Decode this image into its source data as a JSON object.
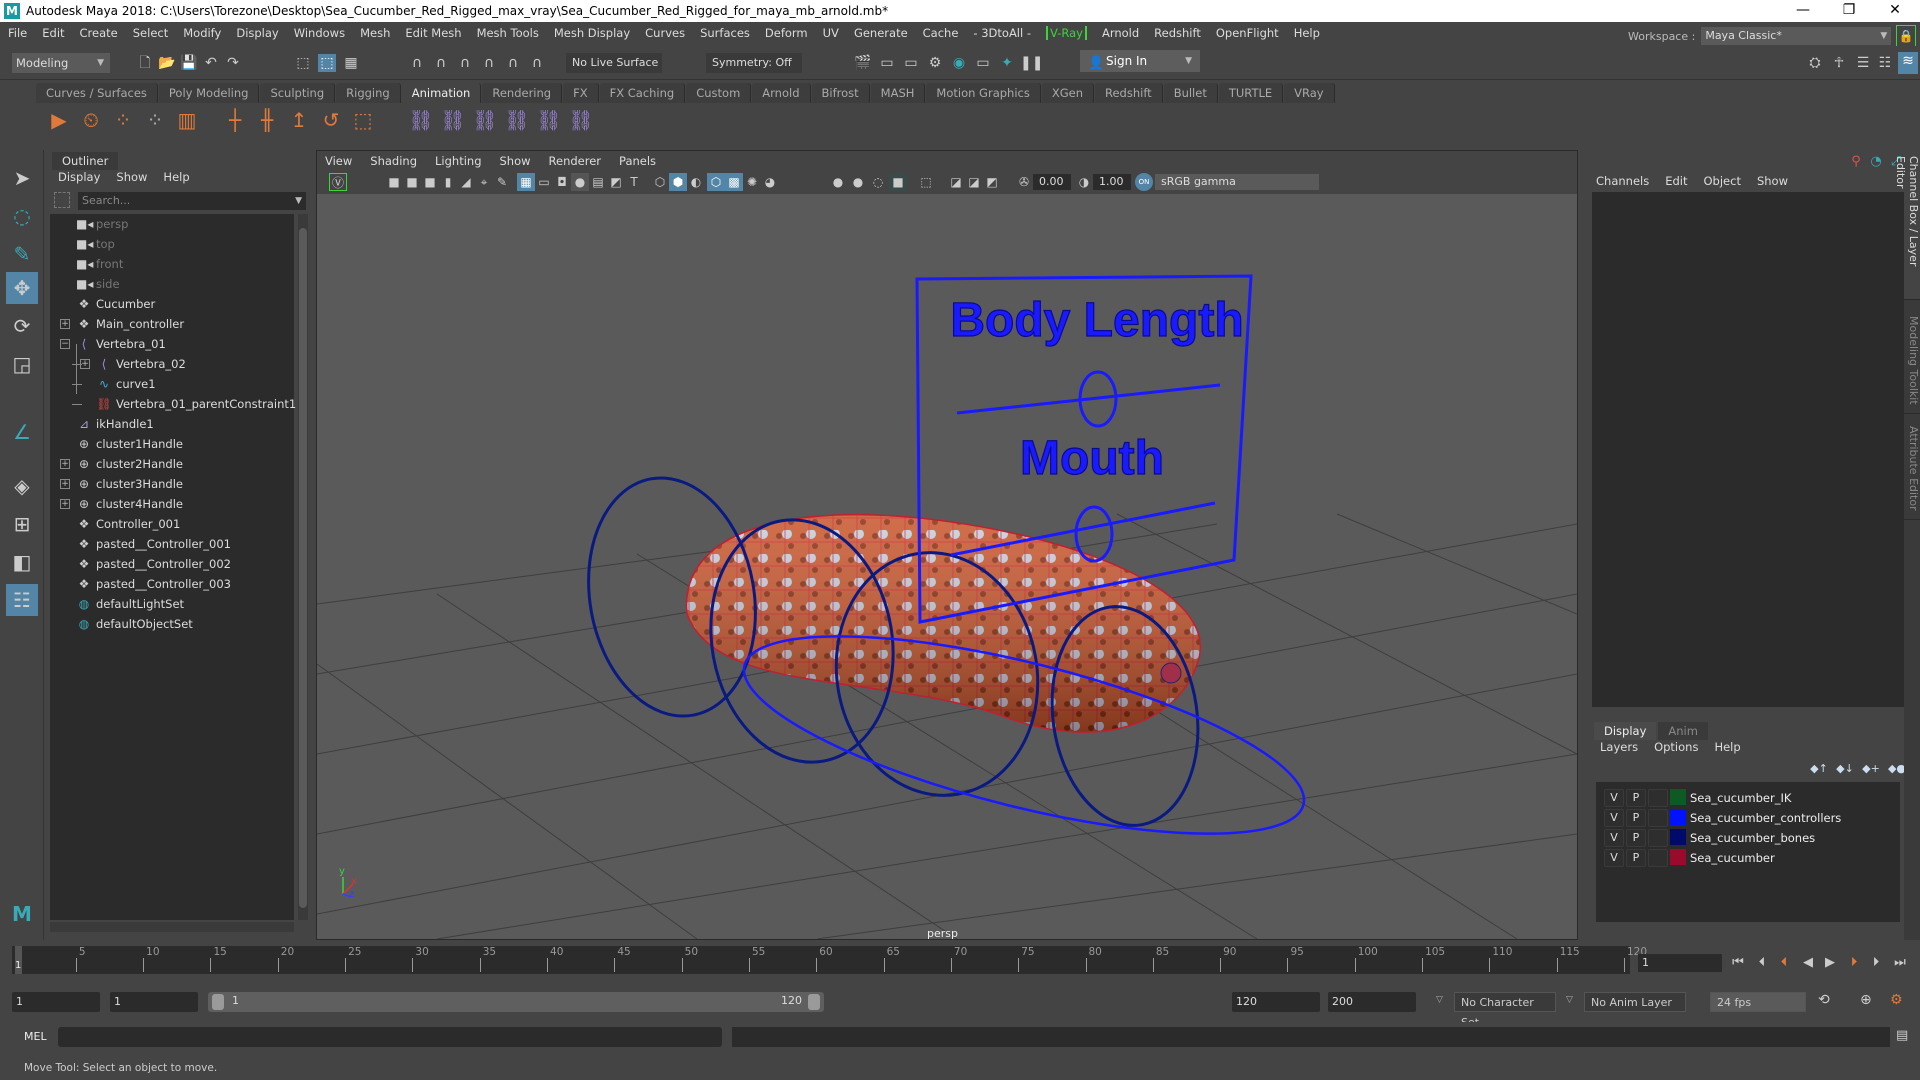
{
  "window": {
    "title": "Autodesk Maya 2018: C:\\Users\\Torezone\\Desktop\\Sea_Cucumber_Red_Rigged_max_vray\\Sea_Cucumber_Red_Rigged_for_maya_mb_arnold.mb*",
    "app_icon": "maya-logo-icon",
    "controls": {
      "minimize": "—",
      "maximize": "❐",
      "close": "✕"
    }
  },
  "menubar": {
    "items": [
      "File",
      "Edit",
      "Create",
      "Select",
      "Modify",
      "Display",
      "Windows",
      "Mesh",
      "Edit Mesh",
      "Mesh Tools",
      "Mesh Display",
      "Curves",
      "Surfaces",
      "Deform",
      "UV",
      "Generate",
      "Cache",
      "- 3DtoAll -",
      "V-Ray",
      "Arnold",
      "Redshift",
      "OpenFlight",
      "Help"
    ],
    "workspace_label": "Workspace :",
    "workspace_value": "Maya Classic*"
  },
  "statusline": {
    "mode": "Modeling",
    "live_surface": "No Live Surface",
    "symmetry": "Symmetry: Off",
    "sign_in": "Sign In"
  },
  "shelf": {
    "tabs": [
      "Curves / Surfaces",
      "Poly Modeling",
      "Sculpting",
      "Rigging",
      "Animation",
      "Rendering",
      "FX",
      "FX Caching",
      "Custom",
      "Arnold",
      "Bifrost",
      "MASH",
      "Motion Graphics",
      "XGen",
      "Redshift",
      "Bullet",
      "TURTLE",
      "VRay"
    ],
    "active_tab": "Animation"
  },
  "outliner": {
    "tab": "Outliner",
    "menu": [
      "Display",
      "Show",
      "Help"
    ],
    "search_placeholder": "Search...",
    "items": [
      {
        "label": "persp",
        "icon": "camera-icon",
        "dim": true,
        "indent": 0,
        "expand": ""
      },
      {
        "label": "top",
        "icon": "camera-icon",
        "dim": true,
        "indent": 0,
        "expand": ""
      },
      {
        "label": "front",
        "icon": "camera-icon",
        "dim": true,
        "indent": 0,
        "expand": ""
      },
      {
        "label": "side",
        "icon": "camera-icon",
        "dim": true,
        "indent": 0,
        "expand": ""
      },
      {
        "label": "Cucumber",
        "icon": "transform-icon",
        "dim": false,
        "indent": 0,
        "expand": ""
      },
      {
        "label": "Main_controller",
        "icon": "transform-icon",
        "dim": false,
        "indent": 0,
        "expand": "+"
      },
      {
        "label": "Vertebra_01",
        "icon": "joint-icon",
        "dim": false,
        "indent": 0,
        "expand": "−"
      },
      {
        "label": "Vertebra_02",
        "icon": "joint-icon",
        "dim": false,
        "indent": 1,
        "expand": "+"
      },
      {
        "label": "curve1",
        "icon": "curve-icon",
        "dim": false,
        "indent": 1,
        "expand": ""
      },
      {
        "label": "Vertebra_01_parentConstraint1",
        "icon": "constraint-icon",
        "dim": false,
        "indent": 1,
        "expand": ""
      },
      {
        "label": "ikHandle1",
        "icon": "ik-handle-icon",
        "dim": false,
        "indent": 0,
        "expand": ""
      },
      {
        "label": "cluster1Handle",
        "icon": "cluster-icon",
        "dim": false,
        "indent": 0,
        "expand": ""
      },
      {
        "label": "cluster2Handle",
        "icon": "cluster-icon",
        "dim": false,
        "indent": 0,
        "expand": "+"
      },
      {
        "label": "cluster3Handle",
        "icon": "cluster-icon",
        "dim": false,
        "indent": 0,
        "expand": "+"
      },
      {
        "label": "cluster4Handle",
        "icon": "cluster-icon",
        "dim": false,
        "indent": 0,
        "expand": "+"
      },
      {
        "label": "Controller_001",
        "icon": "transform-icon",
        "dim": false,
        "indent": 0,
        "expand": ""
      },
      {
        "label": "pasted__Controller_001",
        "icon": "transform-icon",
        "dim": false,
        "indent": 0,
        "expand": ""
      },
      {
        "label": "pasted__Controller_002",
        "icon": "transform-icon",
        "dim": false,
        "indent": 0,
        "expand": ""
      },
      {
        "label": "pasted__Controller_003",
        "icon": "transform-icon",
        "dim": false,
        "indent": 0,
        "expand": ""
      },
      {
        "label": "defaultLightSet",
        "icon": "set-icon",
        "dim": false,
        "indent": 0,
        "expand": ""
      },
      {
        "label": "defaultObjectSet",
        "icon": "set-icon",
        "dim": false,
        "indent": 0,
        "expand": ""
      }
    ]
  },
  "viewport": {
    "menu": [
      "View",
      "Shading",
      "Lighting",
      "Show",
      "Renderer",
      "Panels"
    ],
    "exposure": "0.00",
    "gamma": "1.00",
    "color_space": "sRGB gamma",
    "color_mgmt": "ON",
    "camera_label": "persp",
    "sign_text_1": "Body Length",
    "sign_text_2": "Mouth",
    "axis": {
      "y": "y",
      "x": "x",
      "z": "z"
    }
  },
  "channelbox": {
    "menu": [
      "Channels",
      "Edit",
      "Object",
      "Show"
    ],
    "side_tabs": [
      "Channel Box / Layer Editor",
      "Modeling Toolkit",
      "Attribute Editor"
    ]
  },
  "layers": {
    "tabs": [
      "Display",
      "Anim"
    ],
    "active_tab": "Display",
    "menu": [
      "Layers",
      "Options",
      "Help"
    ],
    "items": [
      {
        "v": "V",
        "p": "P",
        "name": "Sea_cucumber_IK",
        "color": "#0d5a24"
      },
      {
        "v": "V",
        "p": "P",
        "name": "Sea_cucumber_controllers",
        "color": "#0012ff"
      },
      {
        "v": "V",
        "p": "P",
        "name": "Sea_cucumber_bones",
        "color": "#000a6a"
      },
      {
        "v": "V",
        "p": "P",
        "name": "Sea_cucumber",
        "color": "#9a0a2a"
      }
    ]
  },
  "timeline": {
    "ticks": [
      5,
      10,
      15,
      20,
      25,
      30,
      35,
      40,
      45,
      50,
      55,
      60,
      65,
      70,
      75,
      80,
      85,
      90,
      95,
      100,
      105,
      110,
      115,
      120
    ],
    "min": 1,
    "max": 120,
    "current_frame": "1",
    "current_field": "1"
  },
  "range": {
    "start": "1",
    "playback_start": "1",
    "slider_start": "1",
    "slider_end": "120",
    "playback_end": "120",
    "end": "200",
    "character_set": "No Character Set",
    "anim_layer": "No Anim Layer",
    "fps": "24 fps"
  },
  "command": {
    "mel_label": "MEL",
    "help": "Move Tool: Select an object to move."
  },
  "colors": {
    "accent": "#5285a6",
    "controller_blue": "#1a1aff",
    "dark_blue": "#0a1a80",
    "vray_green": "#3bd43b"
  }
}
